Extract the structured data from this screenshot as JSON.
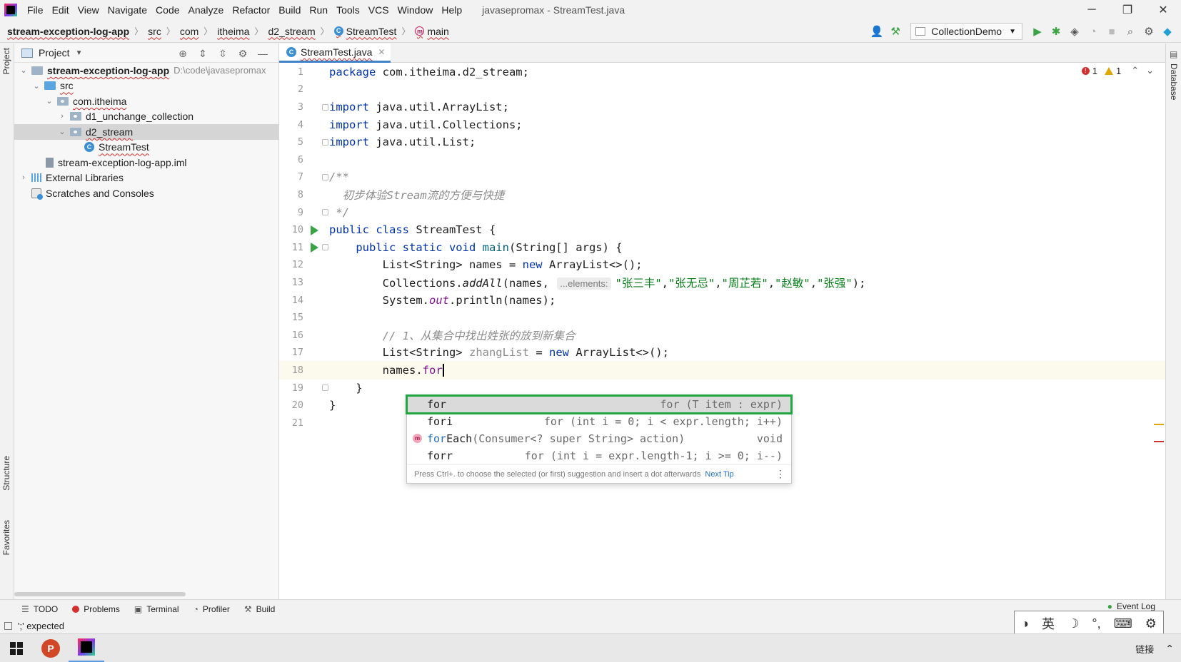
{
  "window": {
    "menu": [
      "File",
      "Edit",
      "View",
      "Navigate",
      "Code",
      "Analyze",
      "Refactor",
      "Build",
      "Run",
      "Tools",
      "VCS",
      "Window",
      "Help"
    ],
    "title": "javasepromax - StreamTest.java",
    "minimize": "─",
    "maximize": "❐",
    "close": "✕"
  },
  "breadcrumb": {
    "project": "stream-exception-log-app",
    "items": [
      "src",
      "com",
      "itheima",
      "d2_stream",
      "StreamTest",
      "main"
    ]
  },
  "toolbar": {
    "run_config": "CollectionDemo"
  },
  "project_panel": {
    "title": "Project",
    "tree": [
      {
        "label": "stream-exception-log-app",
        "extra": "D:\\code\\javasepromax"
      },
      {
        "label": "src"
      },
      {
        "label": "com.itheima"
      },
      {
        "label": "d1_unchange_collection"
      },
      {
        "label": "d2_stream"
      },
      {
        "label": "StreamTest"
      },
      {
        "label": "stream-exception-log-app.iml"
      },
      {
        "label": "External Libraries"
      },
      {
        "label": "Scratches and Consoles"
      }
    ]
  },
  "side_tabs": {
    "project": "Project",
    "structure": "Structure",
    "favorites": "Favorites",
    "database": "Database"
  },
  "editor": {
    "tab": "StreamTest.java",
    "errors": "1",
    "warnings": "1",
    "line_numbers": [
      "1",
      "2",
      "3",
      "4",
      "5",
      "6",
      "7",
      "8",
      "9",
      "10",
      "11",
      "12",
      "13",
      "14",
      "15",
      "16",
      "17",
      "18",
      "19",
      "20",
      "21"
    ],
    "code": {
      "l1_kw": "package",
      "l1_rest": " com.itheima.d2_stream;",
      "import_kw": "import",
      "l3_rest": " java.util.ArrayList;",
      "l4_rest": " java.util.Collections;",
      "l5_rest": " java.util.List;",
      "l7": "/**",
      "l8": "  初步体验Stream流的方便与快捷",
      "l9": " */",
      "l10_kw": "public class",
      "l10_rest": " StreamTest {",
      "l11_kw": "public static void",
      "l11_name": " main",
      "l11_rest": "(String[] args) {",
      "l12_a": "List<String> names = ",
      "new_kw": "new",
      "l12_b": " ArrayList<>();",
      "l13_a": "Collections.",
      "l13_method": "addAll",
      "l13_b": "(names, ",
      "l13_hint": "...elements:",
      "l13_s1": "\"张三丰\"",
      "l13_s2": "\"张无忌\"",
      "l13_s3": "\"周芷若\"",
      "l13_s4": "\"赵敏\"",
      "l13_s5": "\"张强\"",
      "l13_end": ");",
      "l14_a": "System.",
      "l14_out": "out",
      "l14_b": ".println(names);",
      "l16": "// 1、从集合中找出姓张的放到新集合",
      "l17_a": "List<String> ",
      "l17_var": "zhangList",
      "l17_b": " = ",
      "l17_c": " ArrayList<>();",
      "l18_a": "names.",
      "l18_b": "for",
      "l19": "}",
      "l20": "}"
    }
  },
  "completion": {
    "items": [
      {
        "name": "for",
        "tail": "for (T item : expr)"
      },
      {
        "name": "fori",
        "tail": "for (int i = 0; i < expr.length; i++)"
      },
      {
        "name_a": "for",
        "name_b": "Each",
        "sig": "(Consumer<? super String> action)",
        "tail": "void"
      },
      {
        "name": "forr",
        "tail": "for (int i = expr.length-1; i >= 0; i--)"
      }
    ],
    "footer": "Press Ctrl+. to choose the selected (or first) suggestion and insert a dot afterwards",
    "next_tip": "Next Tip"
  },
  "bottom_tools": [
    "TODO",
    "Problems",
    "Terminal",
    "Profiler",
    "Build"
  ],
  "event_log": "Event Log",
  "status": "';' expected",
  "ime": {
    "lang": "英",
    "moon": "☽",
    "punct": "°,",
    "keyboard": "⌨",
    "settings": "⚙"
  },
  "taskbar": {
    "ppt": "P",
    "link": "链接"
  }
}
